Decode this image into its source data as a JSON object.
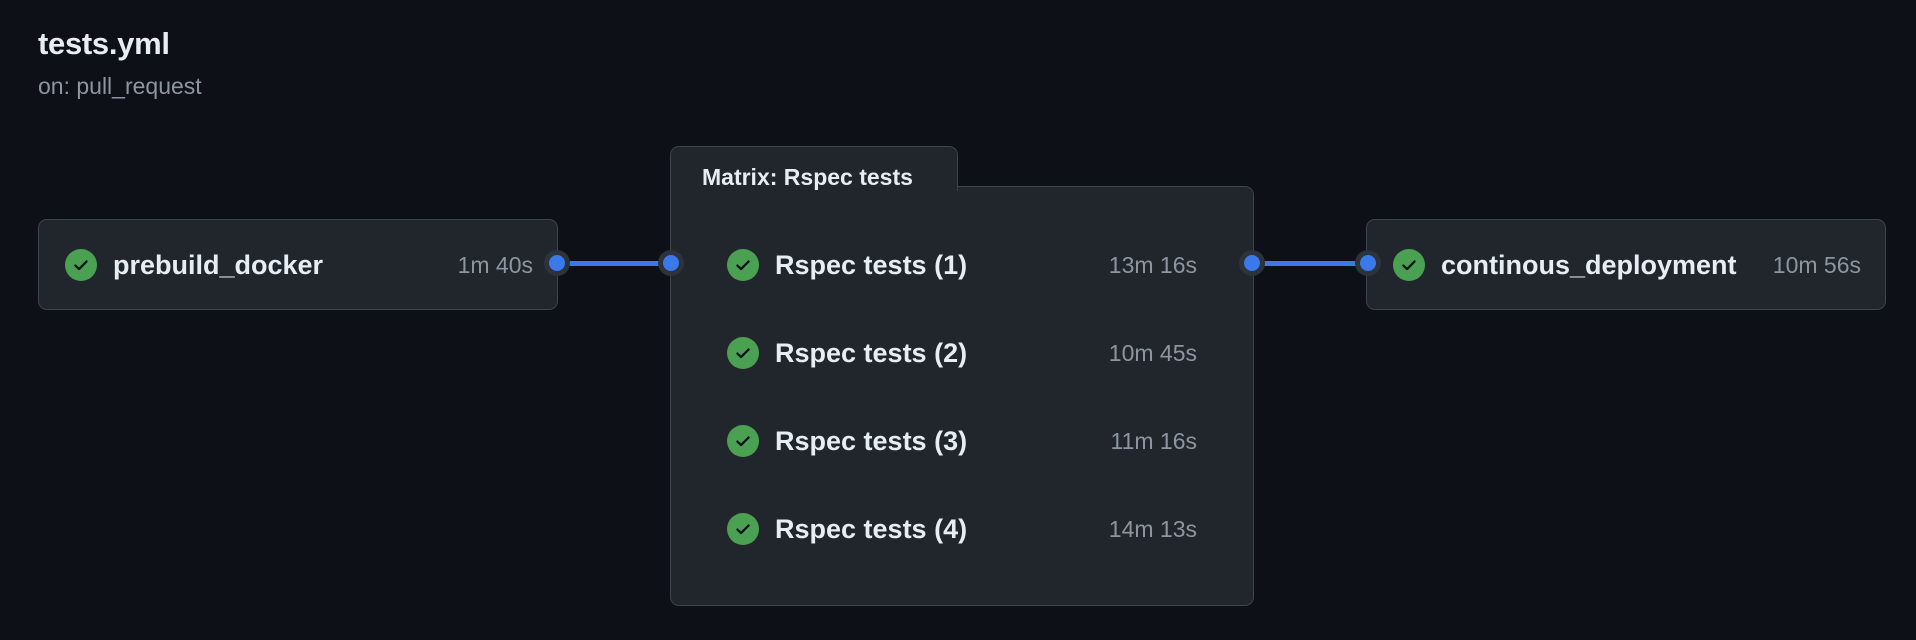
{
  "workflow": {
    "title": "tests.yml",
    "trigger": "on: pull_request"
  },
  "jobs": {
    "prebuild": {
      "name": "prebuild_docker",
      "duration": "1m 40s",
      "status": "success"
    },
    "matrix": {
      "label": "Matrix: Rspec tests",
      "items": [
        {
          "name": "Rspec tests (1)",
          "duration": "13m 16s",
          "status": "success"
        },
        {
          "name": "Rspec tests (2)",
          "duration": "10m 45s",
          "status": "success"
        },
        {
          "name": "Rspec tests (3)",
          "duration": "11m 16s",
          "status": "success"
        },
        {
          "name": "Rspec tests (4)",
          "duration": "14m 13s",
          "status": "success"
        }
      ]
    },
    "deploy": {
      "name": "continous_deployment",
      "duration": "10m 56s",
      "status": "success"
    }
  },
  "icons": {
    "status": "check-circle-icon",
    "port": "connector-dot-icon"
  },
  "colors": {
    "background": "#0d1117",
    "card": "#21262d",
    "card_border": "#3d444d",
    "success": "#4aa152",
    "connector": "#3b78ea",
    "text": "#e6edf3",
    "muted": "#8d96a0"
  }
}
